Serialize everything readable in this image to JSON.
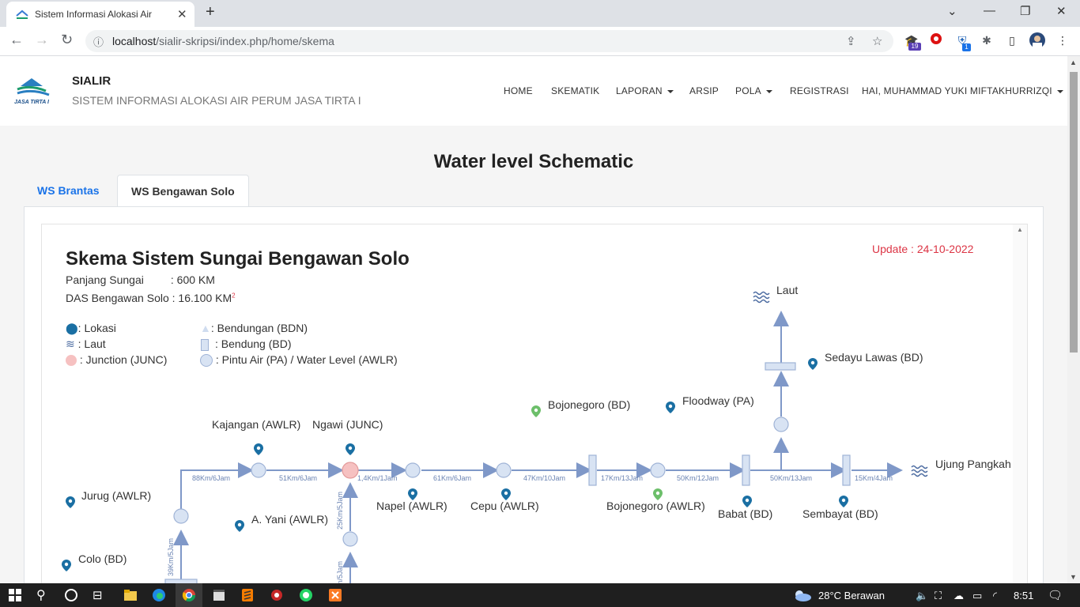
{
  "browser": {
    "tab_title": "Sistem Informasi Alokasi Air",
    "url_host": "localhost",
    "url_path": "/sialir-skripsi/index.php/home/skema",
    "ext_badge_1": "19",
    "ext_badge_2": "1"
  },
  "header": {
    "brand_title": "SIALIR",
    "brand_subtitle": "SISTEM INFORMASI ALOKASI AIR PERUM JASA TIRTA I",
    "logo_text": "JASA TIRTA I",
    "nav": {
      "home": "HOME",
      "skematik": "SKEMATIK",
      "laporan": "LAPORAN",
      "arsip": "ARSIP",
      "pola": "POLA",
      "registrasi": "REGISTRASI",
      "user": "HAI, MUHAMMAD YUKI MIFTAKHURRIZQI"
    }
  },
  "main": {
    "title": "Water level Schematic",
    "tabs": [
      "WS Brantas",
      "WS Bengawan Solo"
    ]
  },
  "schematic": {
    "title": "Skema Sistem Sungai Bengawan Solo",
    "panjang_label": "Panjang Sungai",
    "panjang_value": ": 600 KM",
    "das_label": "DAS Bengawan Solo : 16.100 KM",
    "das_sup": "2",
    "update": "Update : 24-10-2022",
    "legend": {
      "lokasi": ": Lokasi",
      "laut": ": Laut",
      "junction": ": Junction (JUNC)",
      "bendungan": ": Bendungan (BDN)",
      "bendung": ": Bendung (BD)",
      "pintu": ": Pintu Air (PA) / Water Level (AWLR)"
    },
    "labels": {
      "laut": "Laut",
      "sedayu": "Sedayu Lawas (BD)",
      "floodway": "Floodway (PA)",
      "bojonegoro_bd": "Bojonegoro (BD)",
      "kajangan": "Kajangan (AWLR)",
      "ngawi": "Ngawi (JUNC)",
      "jurug": "Jurug (AWLR)",
      "ayani": "A. Yani (AWLR)",
      "colo": "Colo (BD)",
      "napel": "Napel (AWLR)",
      "cepu": "Cepu (AWLR)",
      "bojonegoro_awlr": "Bojonegoro (AWLR)",
      "babat": "Babat (BD)",
      "sembayat": "Sembayat (BD)",
      "ujung": "Ujung Pangkah"
    },
    "distances": {
      "d1": "88Km/6Jam",
      "d2": "51Km/6Jam",
      "d3": "1,4Km/1Jam",
      "d4": "61Km/6Jam",
      "d5": "47Km/10Jam",
      "d6": "17Km/13Jam",
      "d7": "50Km/12Jam",
      "d8": "50Km/13Jam",
      "d9": "15Km/4Jam",
      "d10": "39Km/5Jam",
      "d11": "25Km/5Jam",
      "d12": "m/5Jam"
    }
  },
  "taskbar": {
    "weather": "28°C  Berawan",
    "time": "8:51"
  }
}
